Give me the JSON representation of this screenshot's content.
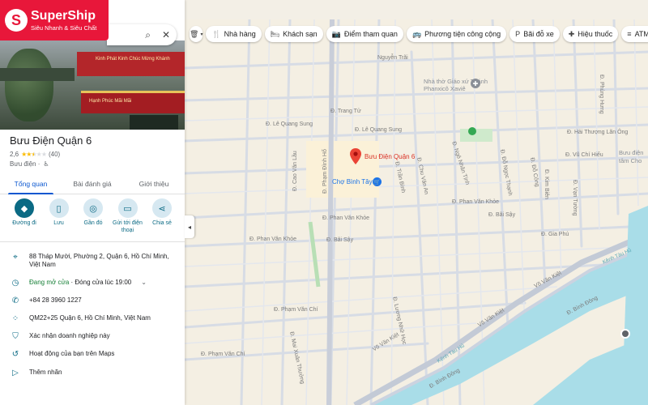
{
  "brand": {
    "initial": "S",
    "name": "SuperShip",
    "tagline": "Siêu Nhanh & Siêu Chất"
  },
  "search": {
    "search_icon": "search-icon",
    "close_icon": "close-icon"
  },
  "photo": {
    "sign_top": "Kinh Phát Kinh Chúc Mừng Khánh",
    "sign_bottom": "Hạnh Phúc Mãi Mãi"
  },
  "place": {
    "title": "Bưu Điện Quận 6",
    "rating": "2,6",
    "stars": 2.6,
    "reviews": "(40)",
    "category": "Bưu điện ·"
  },
  "tabs": [
    {
      "label": "Tổng quan",
      "active": true
    },
    {
      "label": "Bài đánh giá",
      "active": false
    },
    {
      "label": "Giới thiệu",
      "active": false
    }
  ],
  "actions": [
    {
      "label": "Đường đi",
      "icon": "directions-icon"
    },
    {
      "label": "Lưu",
      "icon": "bookmark-icon"
    },
    {
      "label": "Gần đó",
      "icon": "nearby-icon"
    },
    {
      "label": "Gửi tới điện thoại",
      "icon": "phone-send-icon"
    },
    {
      "label": "Chia sẻ",
      "icon": "share-icon"
    }
  ],
  "info": {
    "address": "88 Tháp Mười, Phường 2, Quận 6, Hồ Chí Minh, Việt Nam",
    "hours_open": "Đang mở cửa",
    "hours_rest": " · Đóng cửa lúc 19:00",
    "phone": "+84 28 3960 1227",
    "plus_code": "QM22+25 Quận 6, Hồ Chí Minh, Việt Nam",
    "verify": "Xác nhận doanh nghiệp này",
    "activity": "Hoạt động của bạn trên Maps",
    "add_label": "Thêm nhãn"
  },
  "chips": [
    {
      "label": "Nhà hàng",
      "icon": "restaurant-icon"
    },
    {
      "label": "Khách sạn",
      "icon": "hotel-icon"
    },
    {
      "label": "Điểm tham quan",
      "icon": "camera-icon"
    },
    {
      "label": "Phương tiện công cộng",
      "icon": "transit-icon"
    },
    {
      "label": "Bãi đỗ xe",
      "icon": "parking-icon"
    },
    {
      "label": "Hiệu thuốc",
      "icon": "pharmacy-icon"
    },
    {
      "label": "ATM",
      "icon": "atm-icon"
    }
  ],
  "map": {
    "pin_label": "Bưu Điện Quận 6",
    "market": "Chợ Bình Tây",
    "church": "Nhà thờ Giáo xứ Thánh Phanxicô Xaviê",
    "river_1": "Kênh Tàu Hủ",
    "river_2": "Kênh Tàu Hủ",
    "streets": {
      "nguyen_trai": "Nguyễn Trãi",
      "trang_tu": "Đ. Trang Tử",
      "le_quang_sung_w": "Đ. Lê Quang Sung",
      "le_quang_sung_e": "Đ. Lê Quang Sung",
      "hai_thuong": "Đ. Hải Thượng Lãn Ông",
      "pham_dinh_ho": "Đ. Phạm Đình Hổ",
      "cao_van_lau": "Đ. Cao Văn Lầu",
      "phan_van_khoe_1": "Đ. Phan Văn Khỏe",
      "phan_van_khoe_2": "Đ. Phan Văn Khỏe",
      "phan_van_khoe_3": "Đ. Phan Văn Khỏe",
      "bai_say_1": "Đ. Bãi Sậy",
      "bai_say_2": "Đ. Bãi Sậy",
      "pham_van_chi_1": "Đ. Phạm Văn Chí",
      "pham_van_chi_2": "Đ. Phạm Văn Chí",
      "vo_van_kiet_1": "Võ Văn Kiệt",
      "vo_van_kiet_2": "Võ Văn Kiệt",
      "vo_van_kiet_3": "Võ Văn Kiệt",
      "binh_dong_1": "Đ. Bình Đông",
      "binh_dong_2": "Đ. Bình Đông",
      "ngo_nhan_tinh": "Đ. Ngô Nhân Tịnh",
      "do_ngoc_thanh": "Đ. Đỗ Ngọc Thạnh",
      "chu_van_an": "Đ. Chu Văn An",
      "vu_chi_hieu": "Đ. Vũ Chí Hiếu",
      "gia_phu": "Đ. Gia Phú",
      "phung_hung": "Đ. Phùng Hưng",
      "tran_binh": "Đ. Trần Bình",
      "mai_xuan_thuong": "Đ. Mai Xuân Thưởng",
      "luong_nhu_hoc": "Đ. Lương Nhữ Học",
      "do_cong": "Đ. Đỗ Công",
      "kim_bien": "Đ. Kim Biên",
      "van_tuong": "Đ. Vạn Tường",
      "buu_dien_bk": "Bưu điện tâm Cho"
    }
  }
}
